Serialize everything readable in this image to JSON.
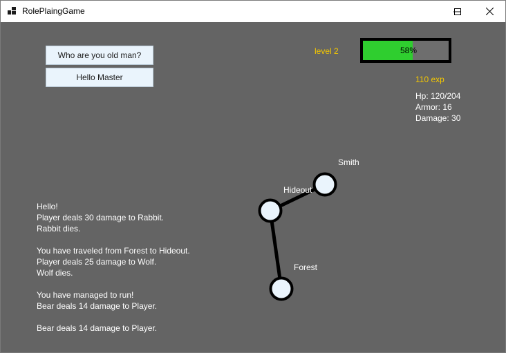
{
  "window": {
    "title": "RolePlaingGame"
  },
  "dialog_options": [
    {
      "label": "Who are you old man?"
    },
    {
      "label": "Hello Master"
    }
  ],
  "player": {
    "level_text": "level 2",
    "xp_progress": 0.58,
    "xp_percent_text": "58%",
    "exp_text": "110 exp",
    "stats": [
      "Hp: 120/204",
      "Armor: 16",
      "Damage: 30"
    ]
  },
  "map": {
    "locations": [
      {
        "name": "Smith"
      },
      {
        "name": "Hideout"
      },
      {
        "name": "Forest"
      }
    ],
    "connections": [
      [
        "Hideout",
        "Smith"
      ],
      [
        "Hideout",
        "Forest"
      ]
    ]
  },
  "log": [
    "Hello!",
    "Player deals 30 damage to Rabbit.",
    "Rabbit dies.",
    "",
    "You have traveled from Forest to Hideout.",
    "Player deals 25 damage to Wolf.",
    "Wolf dies.",
    "",
    "You have managed to run!",
    "Bear deals 14 damage to Player.",
    "",
    "Bear deals 14 damage to Player."
  ],
  "colors": {
    "background": "#646464",
    "accent_yellow": "#f5c800",
    "xp_green": "#2fce2f",
    "node_fill": "#eaf4fc"
  },
  "icons": [
    "app-icon",
    "minimize-icon",
    "maximize-icon",
    "close-icon"
  ]
}
